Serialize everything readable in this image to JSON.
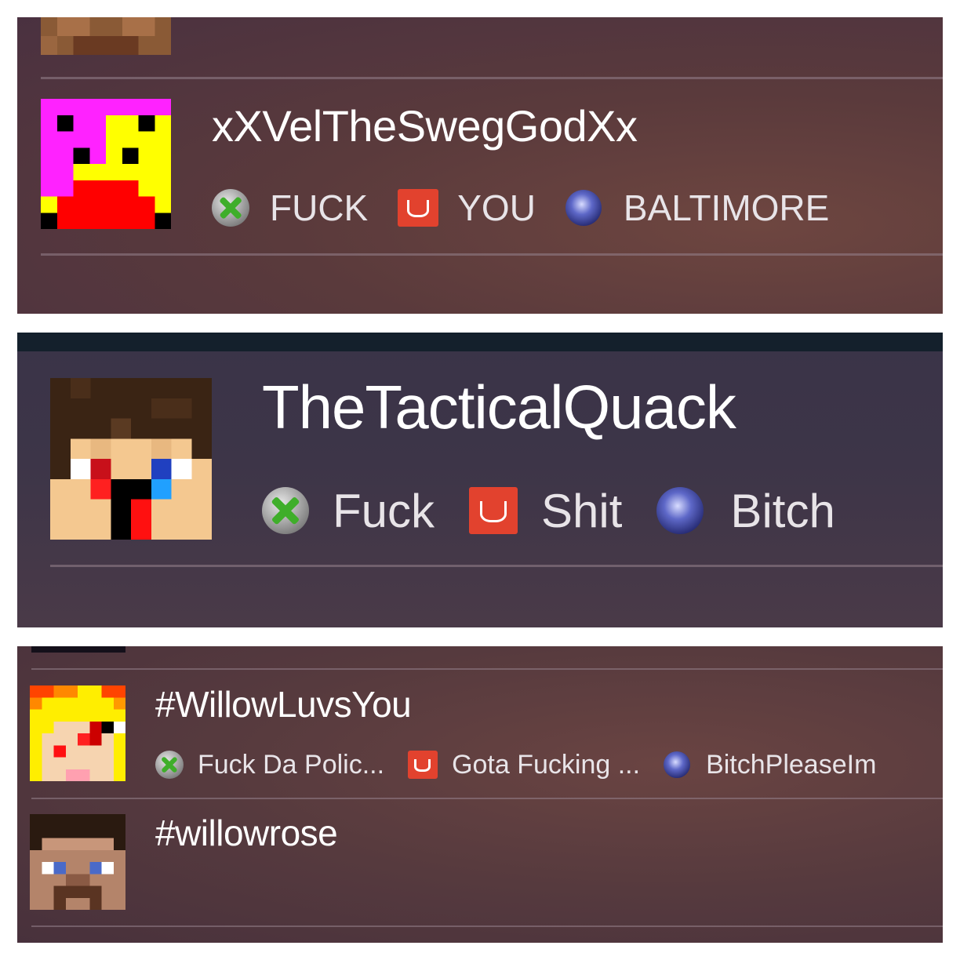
{
  "panel1": {
    "username": "xXVelTheSwegGodXx",
    "platforms": [
      {
        "icon": "xbox-live-icon",
        "value": "FUCK"
      },
      {
        "icon": "origin-icon",
        "value": "YOU"
      },
      {
        "icon": "playstation-network-icon",
        "value": "BALTIMORE"
      }
    ]
  },
  "panel2": {
    "username": "TheTacticalQuack",
    "platforms": [
      {
        "icon": "xbox-live-icon",
        "value": "Fuck"
      },
      {
        "icon": "origin-icon",
        "value": "Shit"
      },
      {
        "icon": "playstation-network-icon",
        "value": "Bitch"
      }
    ]
  },
  "panel3": {
    "entries": [
      {
        "username": "#WillowLuvsYou",
        "platforms": [
          {
            "icon": "xbox-live-icon",
            "value": "Fuck Da Polic..."
          },
          {
            "icon": "origin-icon",
            "value": "Gota Fucking ..."
          },
          {
            "icon": "playstation-network-icon",
            "value": "BitchPleaseIm"
          }
        ]
      },
      {
        "username": "#willowrose"
      }
    ]
  },
  "colors": {
    "xbox_green": "#3fae2a",
    "origin_orange": "#e2422e",
    "psn_blue": "#3a44b0",
    "text": "#ffffff"
  }
}
